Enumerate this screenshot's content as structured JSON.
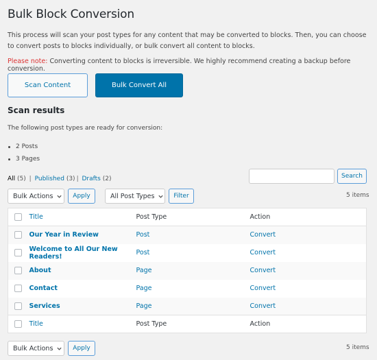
{
  "page": {
    "title": "Bulk Block Conversion",
    "intro": "This process will scan your post types for any content that may be converted to blocks. Then, you can choose to convert posts to blocks individually, or bulk convert all content to blocks.",
    "note_label": "Please note:",
    "note_text": " Converting content to blocks is irreversible. We highly recommend creating a backup before conversion.",
    "colors": {
      "accent": "#0073aa",
      "warning": "#dc3232",
      "background": "#f1f1f1"
    }
  },
  "actions": {
    "scan_label": "Scan Content",
    "bulk_convert_label": "Bulk Convert All"
  },
  "results": {
    "heading": "Scan results",
    "ready_text": "The following post types are ready for conversion:",
    "types": [
      {
        "count": "2",
        "label": "Posts"
      },
      {
        "count": "3",
        "label": "Pages"
      }
    ]
  },
  "views": {
    "all_label": "All",
    "all_count": "(5)",
    "published_label": "Published",
    "published_count": "(3)",
    "drafts_label": "Drafts",
    "drafts_count": "(2)",
    "separator": "|"
  },
  "search": {
    "value": "",
    "placeholder": "",
    "button_label": "Search"
  },
  "toolbar_top": {
    "bulk_actions_selected": "Bulk Actions",
    "apply_label": "Apply",
    "post_type_selected": "All Post Types",
    "filter_label": "Filter",
    "items_count": "5 items"
  },
  "table": {
    "columns": {
      "title": "Title",
      "post_type": "Post Type",
      "action": "Action"
    },
    "rows": [
      {
        "title": "Our Year in Review",
        "post_type": "Post",
        "action": "Convert"
      },
      {
        "title": "Welcome to All Our New Readers!",
        "post_type": "Post",
        "action": "Convert"
      },
      {
        "title": "About",
        "post_type": "Page",
        "action": "Convert"
      },
      {
        "title": "Contact",
        "post_type": "Page",
        "action": "Convert"
      },
      {
        "title": "Services",
        "post_type": "Page",
        "action": "Convert"
      }
    ]
  },
  "toolbar_bottom": {
    "bulk_actions_selected": "Bulk Actions",
    "apply_label": "Apply",
    "items_count": "5 items"
  }
}
